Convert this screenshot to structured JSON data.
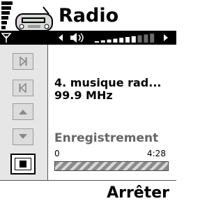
{
  "header": {
    "title": "Radio"
  },
  "station": {
    "name": "4. musique rad...",
    "frequency": "99.9 MHz"
  },
  "recording": {
    "label": "Enregistrement",
    "start_time": "0",
    "end_time": "4:28",
    "progress": 1.0
  },
  "controls": [
    {
      "icon": "skip-next-icon"
    },
    {
      "icon": "skip-previous-icon"
    },
    {
      "icon": "arrow-up-icon"
    },
    {
      "icon": "arrow-down-icon"
    },
    {
      "icon": "stop-icon",
      "selected": true
    }
  ],
  "volume": {
    "level": 7,
    "max": 10
  },
  "softkeys": {
    "right": "Arrêter"
  }
}
